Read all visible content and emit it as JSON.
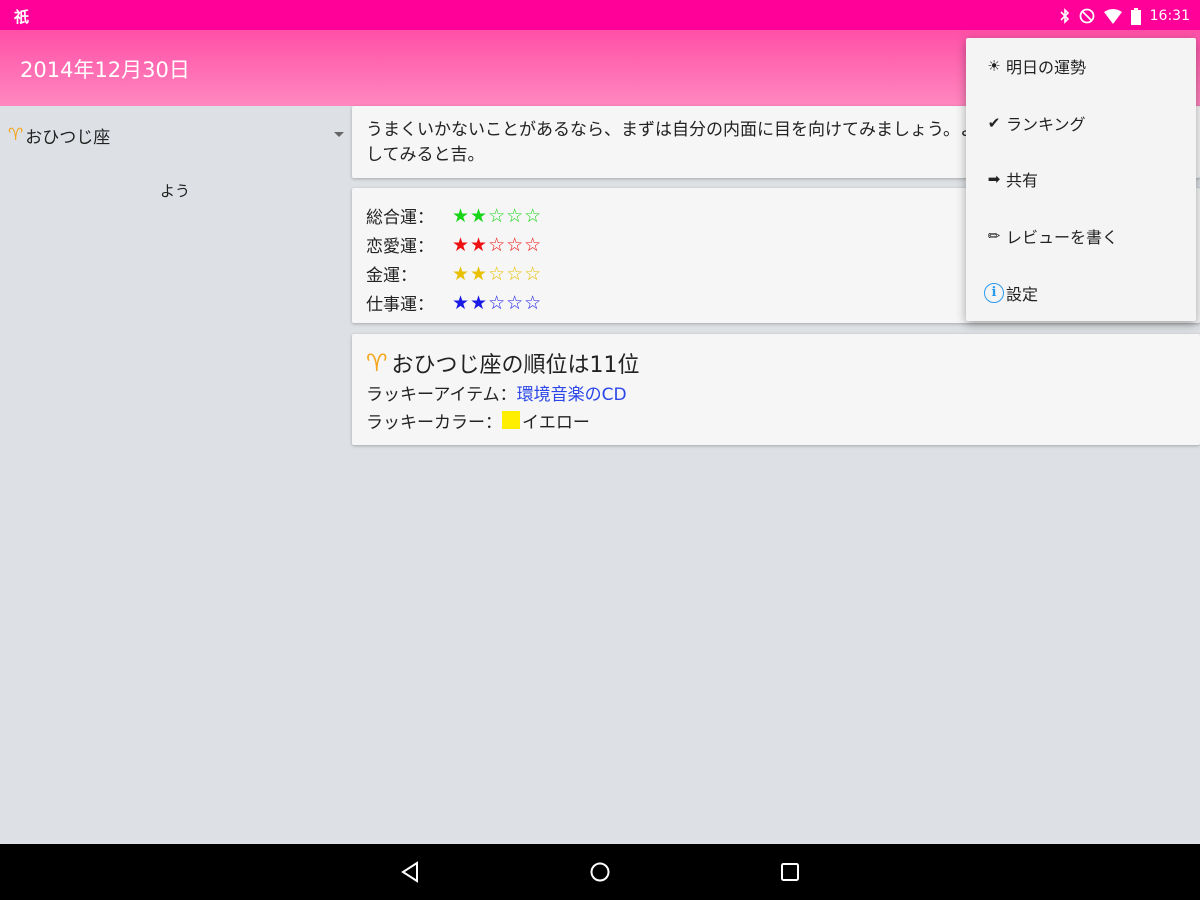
{
  "status_bar": {
    "left_icon": "notification-app-icon",
    "left_glyph": "祇",
    "time": "16:31",
    "icons": [
      "bluetooth-icon",
      "do-not-disturb-icon",
      "wifi-icon",
      "battery-icon"
    ]
  },
  "app_bar": {
    "title": "2014年12月30日"
  },
  "left_pane": {
    "sign_glyph": "♈",
    "sign_name": "おひつじ座",
    "fragment_text": "よう"
  },
  "message": {
    "text": "うまくいかないことがあるなら、まずは自分の内面に目を向けてみましょう。よくない習慣はないか、見直してみると吉。"
  },
  "luck": [
    {
      "label": "総合運：",
      "stars": "★★☆☆☆",
      "rating": 2,
      "color": "#19d419"
    },
    {
      "label": "恋愛運：",
      "stars": "★★☆☆☆",
      "rating": 2,
      "color": "#ee1111"
    },
    {
      "label": "金運：",
      "stars": "★★☆☆☆",
      "rating": 2,
      "color": "#e8c000"
    },
    {
      "label": "仕事運：",
      "stars": "★★☆☆☆",
      "rating": 2,
      "color": "#1a1ae6"
    }
  ],
  "ranking": {
    "glyph": "♈",
    "title": "おひつじ座の順位は11位",
    "item_label": "ラッキーアイテム：",
    "item_value": "環境音楽のCD",
    "color_label": "ラッキーカラー：",
    "color_value": "イエロー",
    "color_swatch": "#ffee00"
  },
  "menu": {
    "items": [
      {
        "icon": "sun-icon",
        "glyph": "☀",
        "label": "明日の運勢"
      },
      {
        "icon": "check-icon",
        "glyph": "✔",
        "label": "ランキング"
      },
      {
        "icon": "arrow-right-icon",
        "glyph": "➡",
        "label": "共有"
      },
      {
        "icon": "pencil-icon",
        "glyph": "✏",
        "label": "レビューを書く"
      },
      {
        "icon": "info-icon",
        "glyph": "i",
        "label": "設定"
      }
    ]
  },
  "nav": {
    "buttons": [
      "back-icon",
      "home-icon",
      "recents-icon"
    ]
  },
  "colors": {
    "status_bar": "#ff0099",
    "app_bar": "#ff5aa8",
    "aries": "#f4a51c",
    "link": "#2b46e8"
  }
}
